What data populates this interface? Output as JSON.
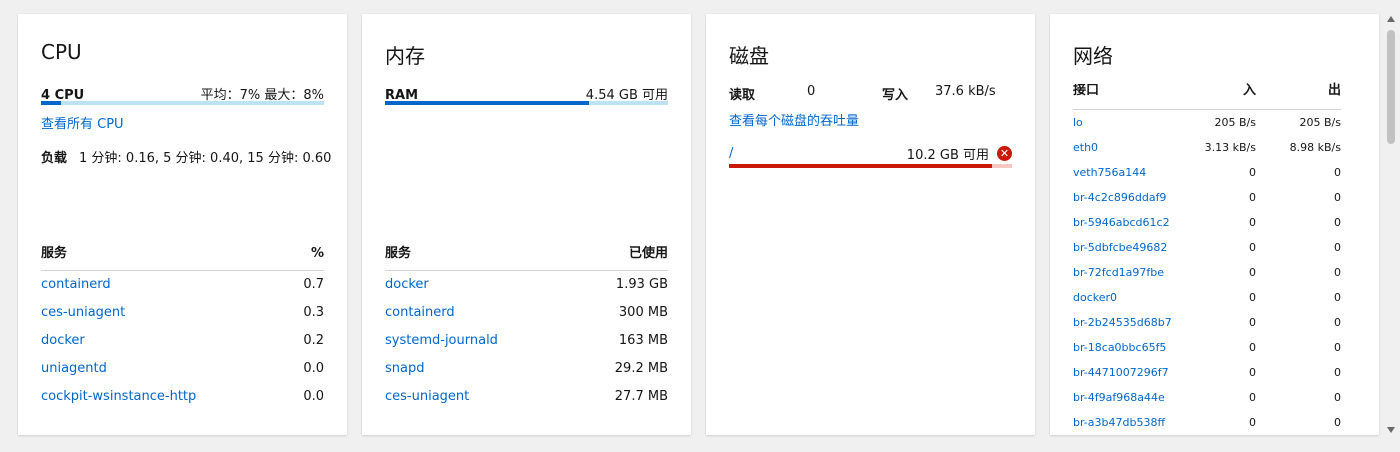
{
  "cpu": {
    "title": "CPU",
    "bar_label": "4 CPU",
    "bar_stats": "平均：7% 最大：8%",
    "usage_fraction": 0.07,
    "view_all_link": "查看所有 CPU",
    "load_label": "负载",
    "load_value": "1 分钟: 0.16, 5 分钟: 0.40, 15 分钟: 0.60",
    "table_header": {
      "name": "服务",
      "value": "%"
    },
    "services": [
      {
        "name": "containerd",
        "value": "0.7"
      },
      {
        "name": "ces-uniagent",
        "value": "0.3"
      },
      {
        "name": "docker",
        "value": "0.2"
      },
      {
        "name": "uniagentd",
        "value": "0.0"
      },
      {
        "name": "cockpit-wsinstance-http",
        "value": "0.0"
      }
    ]
  },
  "memory": {
    "title": "内存",
    "bar_label": "RAM",
    "bar_stats": "4.54 GB 可用",
    "usage_fraction": 0.72,
    "table_header": {
      "name": "服务",
      "value": "已使用"
    },
    "services": [
      {
        "name": "docker",
        "value": "1.93 GB"
      },
      {
        "name": "containerd",
        "value": "300 MB"
      },
      {
        "name": "systemd-journald",
        "value": "163 MB"
      },
      {
        "name": "snapd",
        "value": "29.2 MB"
      },
      {
        "name": "ces-uniagent",
        "value": "27.7 MB"
      }
    ]
  },
  "disk": {
    "title": "磁盘",
    "read_label": "读取",
    "read_value": "0",
    "write_label": "写入",
    "write_value": "37.6 kB/s",
    "view_link": "查看每个磁盘的吞吐量",
    "mount": "/",
    "mount_free": "10.2 GB 可用",
    "usage_fraction": 0.93,
    "colors": {
      "bar": "#c9190b",
      "track": "#f9c7c2"
    }
  },
  "network": {
    "title": "网络",
    "header": {
      "name": "接口",
      "in": "入",
      "out": "出"
    },
    "interfaces": [
      {
        "name": "lo",
        "in": "205 B/s",
        "out": "205 B/s"
      },
      {
        "name": "eth0",
        "in": "3.13 kB/s",
        "out": "8.98 kB/s"
      },
      {
        "name": "veth756a144",
        "in": "0",
        "out": "0"
      },
      {
        "name": "br-4c2c896ddaf9",
        "in": "0",
        "out": "0"
      },
      {
        "name": "br-5946abcd61c2",
        "in": "0",
        "out": "0"
      },
      {
        "name": "br-5dbfcbe49682",
        "in": "0",
        "out": "0"
      },
      {
        "name": "br-72fcd1a97fbe",
        "in": "0",
        "out": "0"
      },
      {
        "name": "docker0",
        "in": "0",
        "out": "0"
      },
      {
        "name": "br-2b24535d68b7",
        "in": "0",
        "out": "0"
      },
      {
        "name": "br-18ca0bbc65f5",
        "in": "0",
        "out": "0"
      },
      {
        "name": "br-4471007296f7",
        "in": "0",
        "out": "0"
      },
      {
        "name": "br-4f9af968a44e",
        "in": "0",
        "out": "0"
      },
      {
        "name": "br-a3b47db538ff",
        "in": "0",
        "out": "0"
      }
    ]
  },
  "colors": {
    "link": "#0066cc",
    "bar_fill": "#0066cc",
    "bar_track": "#bee1f4"
  }
}
